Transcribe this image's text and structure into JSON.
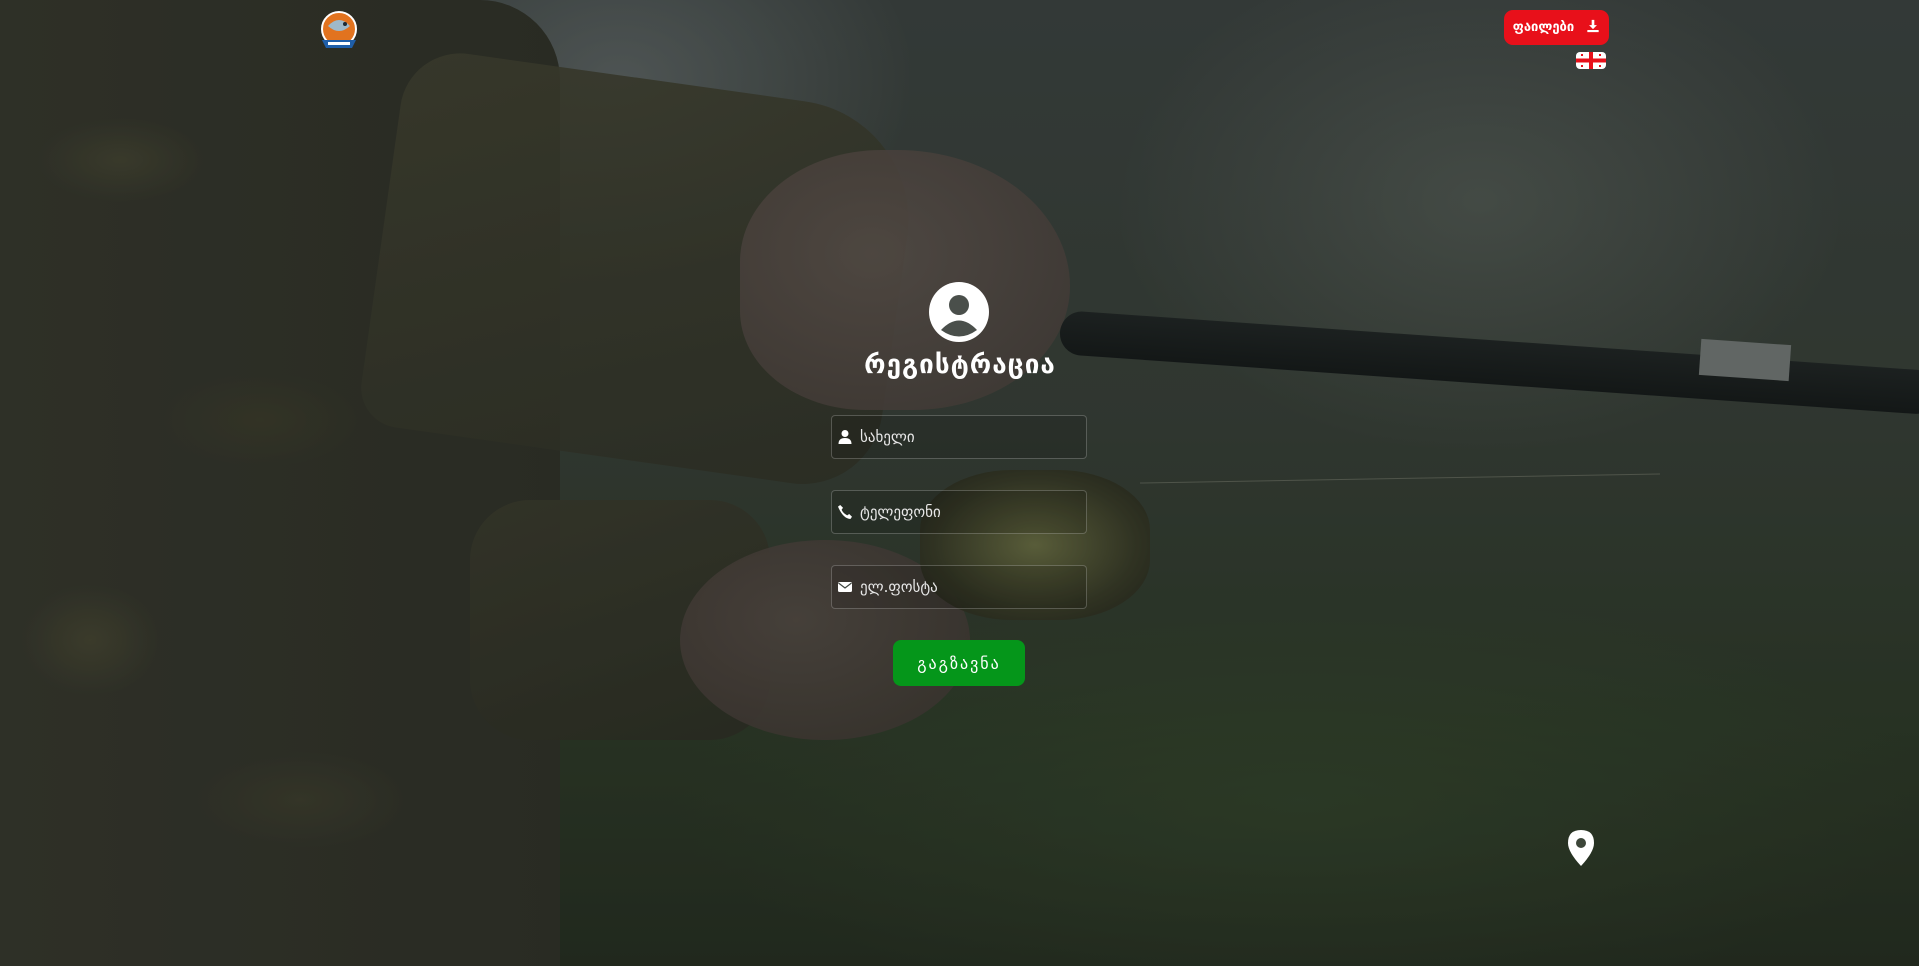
{
  "header": {
    "logo_icon": "fishing-club-logo",
    "files_button": {
      "label": "ფაილები",
      "icon": "download-icon",
      "color": "#e8101a"
    },
    "language_flag_icon": "georgian-flag-icon"
  },
  "form": {
    "avatar_icon": "user-circle-icon",
    "title": "რეგისტრაცია",
    "fields": [
      {
        "name": "name",
        "icon": "user-icon",
        "placeholder": "სახელი",
        "value": ""
      },
      {
        "name": "phone",
        "icon": "phone-icon",
        "placeholder": "ტელეფონი",
        "value": ""
      },
      {
        "name": "email",
        "icon": "envelope-icon",
        "placeholder": "ელ.ფოსტა",
        "value": ""
      }
    ],
    "submit_label": "გაგზავნა",
    "submit_color": "#05961a"
  },
  "location_icon": "map-marker-icon"
}
